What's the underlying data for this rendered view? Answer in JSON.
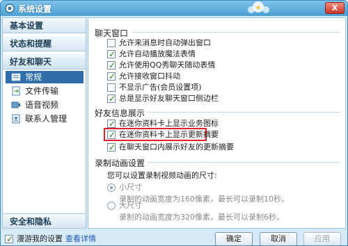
{
  "window": {
    "title": "系统设置",
    "close_label": "X"
  },
  "sidebar": {
    "categories": [
      {
        "label": "基本设置"
      },
      {
        "label": "状态和提醒"
      },
      {
        "label": "好友和聊天"
      },
      {
        "label": "安全和隐私"
      }
    ],
    "items": [
      {
        "label": "常规",
        "icon": "settings-icon",
        "selected": true
      },
      {
        "label": "文件传输",
        "icon": "file-transfer-icon"
      },
      {
        "label": "语音视频",
        "icon": "audio-video-icon"
      },
      {
        "label": "联系人管理",
        "icon": "contacts-icon"
      }
    ]
  },
  "chat_window": {
    "title": "聊天窗口",
    "options": [
      {
        "label": "允许来消息时自动弹出窗口",
        "checked": false
      },
      {
        "label": "允许自动播放魔法表情",
        "checked": true
      },
      {
        "label": "允许使用QQ秀聊天随动表情",
        "checked": true
      },
      {
        "label": "允许接收窗口抖动",
        "checked": true
      },
      {
        "label": "不显示广告(会员设置项)",
        "checked": false
      },
      {
        "label": "总是显示好友聊天窗口侧边栏",
        "checked": true
      }
    ]
  },
  "friend_info": {
    "title": "好友信息展示",
    "options": [
      {
        "label": "在迷你资料卡上显示业务图标",
        "checked": true
      },
      {
        "label": "在迷你资料卡上显示更新摘要",
        "checked": true,
        "highlighted": true
      },
      {
        "label": "在聊天窗口内展示好友的更新摘要",
        "checked": true
      }
    ]
  },
  "recording": {
    "title": "录制动画设置",
    "prompt": "您可以设置录制视频动画的尺寸:",
    "options": [
      {
        "label": "小尺寸",
        "note": "录制的动画宽度为160像素，最长可以录制10秒。",
        "selected": true
      },
      {
        "label": "大尺寸",
        "note": "录制的动画宽度为320像素，最长可以录制6秒。",
        "selected": false
      }
    ]
  },
  "footer": {
    "roam_label": "漫游我的设置",
    "roam_checked": true,
    "details_link": "查看详情",
    "ok_label": "确定",
    "cancel_label": "取消",
    "apply_label": "应用"
  }
}
